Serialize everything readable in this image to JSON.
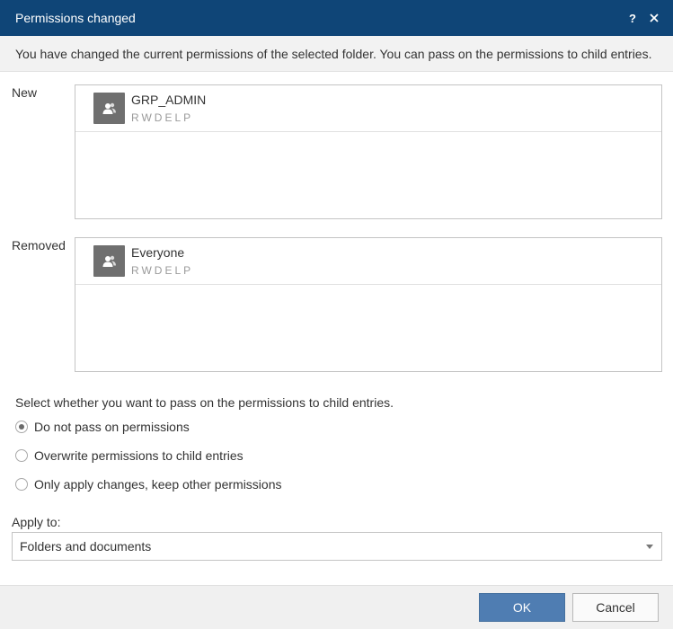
{
  "dialog": {
    "title": "Permissions changed",
    "help_icon": "question-icon",
    "close_icon": "close-icon",
    "info_text": "You have changed the current permissions of the selected folder. You can pass on the permissions to child entries."
  },
  "new_section": {
    "label": "New",
    "items": [
      {
        "name": "GRP_ADMIN",
        "rights": "RWDELP",
        "icon": "user-group-icon"
      }
    ]
  },
  "removed_section": {
    "label": "Removed",
    "items": [
      {
        "name": "Everyone",
        "rights": "RWDELP",
        "icon": "user-group-icon"
      }
    ]
  },
  "pass_on": {
    "question": "Select whether you want to pass on the permissions to child entries.",
    "options": [
      {
        "label": "Do not pass on permissions",
        "selected": true
      },
      {
        "label": "Overwrite permissions to child entries",
        "selected": false
      },
      {
        "label": "Only apply changes, keep other permissions",
        "selected": false
      }
    ]
  },
  "apply_to": {
    "label": "Apply to:",
    "value": "Folders and documents"
  },
  "footer": {
    "ok_label": "OK",
    "cancel_label": "Cancel"
  },
  "colors": {
    "titlebar": "#0f4577",
    "primary_button": "#4f7db2",
    "avatar": "#6f6f6f"
  }
}
